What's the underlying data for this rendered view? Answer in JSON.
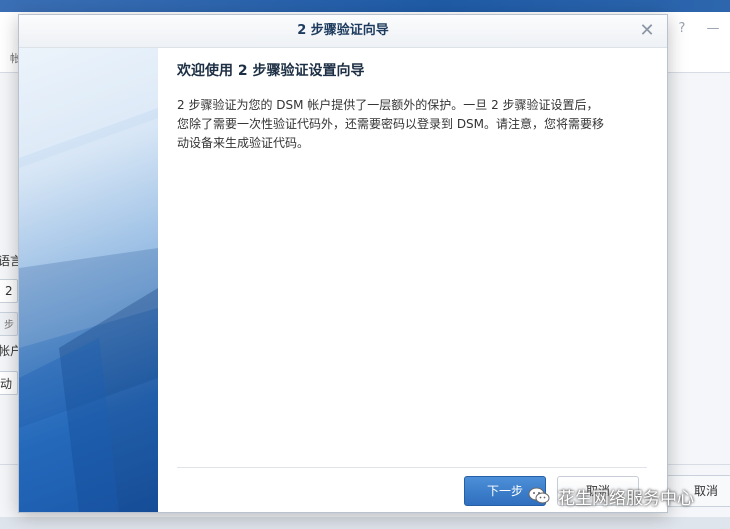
{
  "background_app": {
    "left_labels": [
      "帐",
      "语言",
      "2",
      "步",
      "帐户",
      "动"
    ],
    "cancel_label": "取消",
    "header_icons": [
      "help-icon",
      "minimize-icon"
    ]
  },
  "dialog": {
    "title": "2 步骤验证向导",
    "close_icon": "close-icon",
    "heading": "欢迎使用 2 步骤验证设置向导",
    "body_lines": [
      "2 步骤验证为您的 DSM 帐户提供了一层额外的保护。一旦 2 步骤验证设置后，",
      "您除了需要一次性验证代码外，还需要密码以登录到 DSM。请注意，您将需要移",
      "动设备来生成验证代码。"
    ],
    "next_label": "下一步",
    "cancel_label": "取消"
  },
  "watermark": {
    "text": "花生网络服务中心",
    "icon": "wechat-icon"
  },
  "colors": {
    "accent": "#2f6fbf",
    "title": "#1d3b5e"
  }
}
